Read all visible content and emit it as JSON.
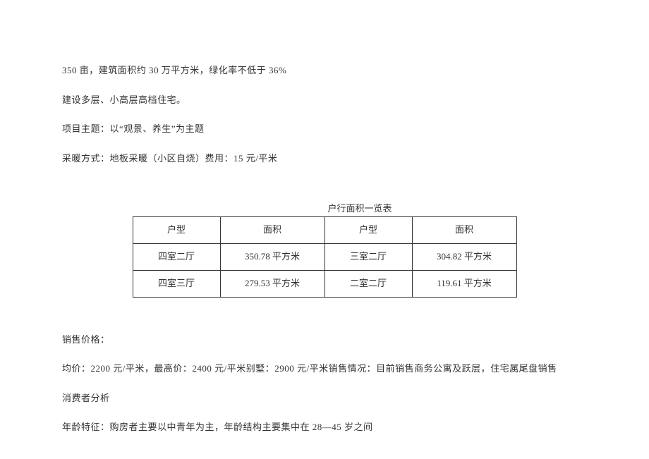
{
  "paragraphs": {
    "p1": "350 亩，建筑面积约 30 万平方米，绿化率不低于 36%",
    "p2": "建设多层、小高层高档住宅。",
    "p3": "项目主题：以“观景、养生”为主题",
    "p4": "采暖方式：地板采暖（小区自烧）费用：15 元/平米"
  },
  "table": {
    "title": "户行面积一览表",
    "headers": {
      "h1": "户型",
      "h2": "面积",
      "h3": "户型",
      "h4": "面积"
    },
    "rows": [
      {
        "c1": "四室二厅",
        "c2": "350.78 平方米",
        "c3": "三室二厅",
        "c4": "304.82 平方米"
      },
      {
        "c1": "四室三厅",
        "c2": "279.53 平方米",
        "c3": "二室二厅",
        "c4": "119.61 平方米"
      }
    ]
  },
  "paragraphs2": {
    "p5": "销售价格：",
    "p6": "均价：2200 元/平米，最高价：2400 元/平米别墅：2900 元/平米销售情况：目前销售商务公寓及跃层，住宅属尾盘销售",
    "p7": "消费者分析",
    "p8": "年龄特征：购房者主要以中青年为主，年龄结构主要集中在 28—45 岁之间"
  }
}
